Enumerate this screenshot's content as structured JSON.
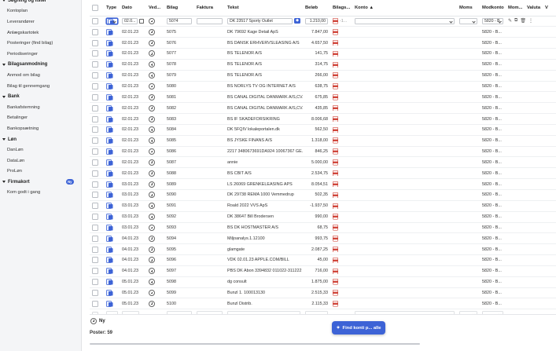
{
  "sidebar": {
    "items": [
      {
        "kind": "section",
        "label": "Søgning og lister"
      },
      {
        "kind": "item",
        "label": "Kontoplan"
      },
      {
        "kind": "item",
        "label": "Leverandører"
      },
      {
        "kind": "item",
        "label": "Anlægskartotek"
      },
      {
        "kind": "item",
        "label": "Posteringer (find bilag)"
      },
      {
        "kind": "item",
        "label": "Periodiseringer"
      },
      {
        "kind": "section",
        "label": "Bilagsanmodning"
      },
      {
        "kind": "item",
        "label": "Anmod om bilag"
      },
      {
        "kind": "item",
        "label": "Bilag til gennemgang"
      },
      {
        "kind": "section",
        "label": "Bank"
      },
      {
        "kind": "item",
        "label": "Bankafstemning"
      },
      {
        "kind": "item",
        "label": "Betalinger"
      },
      {
        "kind": "item",
        "label": "Bankopsætning"
      },
      {
        "kind": "section",
        "label": "Løn"
      },
      {
        "kind": "item",
        "label": "DanLøn"
      },
      {
        "kind": "item",
        "label": "DataLøn"
      },
      {
        "kind": "item",
        "label": "ProLøn"
      },
      {
        "kind": "section",
        "label": "Firmakort",
        "badge": "Ny"
      },
      {
        "kind": "item",
        "label": "Kom godt i gang"
      }
    ]
  },
  "table": {
    "columns": {
      "type": "Type",
      "dato": "Dato",
      "ved": "Ved...",
      "bilag": "Bilag",
      "faktura": "Faktura",
      "tekst": "Tekst",
      "belob": "Beløb",
      "bilags": "Bilags...",
      "konto": "Konto",
      "sort_indicator": "▲",
      "moms": "Moms",
      "modkonto": "Modkonto",
      "mom": "Mom...",
      "valuta": "Valuta",
      "v": "V"
    },
    "first_row": {
      "dato": "02.0...",
      "bilag": "5074",
      "tekst": "DK 23517 Sporty Outlet",
      "belob": "1.210,00",
      "bilags": "-1...",
      "modkonto": "5820 - B..."
    },
    "rows": [
      {
        "dato": "02.01.23",
        "bilag": "5075",
        "tekst": "DK 79692 Kage Detail ApS",
        "belob": "7.847,00",
        "modkonto": "5820 - B..."
      },
      {
        "dato": "02.01.23",
        "bilag": "5076",
        "tekst": "BS DANSK ERHVERVSLEASING A/S",
        "belob": "4.657,50",
        "modkonto": "5820 - B..."
      },
      {
        "dato": "02.01.23",
        "bilag": "5077",
        "tekst": "BS TELENOR A/S",
        "belob": "141,75",
        "modkonto": "5820 - B..."
      },
      {
        "dato": "02.01.23",
        "bilag": "5078",
        "tekst": "BS TELENOR A/S",
        "belob": "314,75",
        "modkonto": "5820 - B..."
      },
      {
        "dato": "02.01.23",
        "bilag": "5079",
        "tekst": "BS TELENOR A/S",
        "belob": "266,00",
        "modkonto": "5820 - B..."
      },
      {
        "dato": "02.01.23",
        "bilag": "5080",
        "tekst": "BS NORLYS TV OG INTERNET A/S",
        "belob": "638,75",
        "modkonto": "5820 - B..."
      },
      {
        "dato": "02.01.23",
        "bilag": "5081",
        "tekst": "BS CANAL DIGITAL DANMARK A/S,CV...",
        "belob": "675,85",
        "modkonto": "5820 - B..."
      },
      {
        "dato": "02.01.23",
        "bilag": "5082",
        "tekst": "BS CANAL DIGITAL DANMARK A/S,CV...",
        "belob": "435,85",
        "modkonto": "5820 - B..."
      },
      {
        "dato": "02.01.23",
        "bilag": "5083",
        "tekst": "BS IF SKADEFORSIKRING",
        "belob": "8.006,68",
        "modkonto": "5820 - B..."
      },
      {
        "dato": "02.01.23",
        "bilag": "5084",
        "tekst": "DK 5FQIV lokaleportalen.dk",
        "belob": "562,50",
        "modkonto": "5820 - B..."
      },
      {
        "dato": "02.01.23",
        "bilag": "5085",
        "tekst": "BS JYSKE FINANS A/S",
        "belob": "1.318,00",
        "modkonto": "5820 - B..."
      },
      {
        "dato": "02.01.23",
        "bilag": "5086",
        "tekst": "2217 3480673691DA924 10067367 GE...",
        "belob": "846,25",
        "modkonto": "5820 - B..."
      },
      {
        "dato": "02.01.23",
        "bilag": "5087",
        "tekst": "annie",
        "belob": "5.000,00",
        "modkonto": "5820 - B..."
      },
      {
        "dato": "02.01.23",
        "bilag": "5088",
        "tekst": "BS CBIT A/S",
        "belob": "2.534,75",
        "modkonto": "5820 - B..."
      },
      {
        "dato": "03.01.23",
        "bilag": "5089",
        "tekst": "LS 26069 GRENKELEASING APS",
        "belob": "8.054,51",
        "modkonto": "5820 - B..."
      },
      {
        "dato": "03.01.23",
        "bilag": "5090",
        "tekst": "DK 29738 REMA 1000 Vemmedrup",
        "belob": "502,35",
        "modkonto": "5820 - B..."
      },
      {
        "dato": "03.01.23",
        "bilag": "5091",
        "tekst": "Roald 2022 VVS ApS",
        "belob": "-1.937,50",
        "modkonto": "5820 - B..."
      },
      {
        "dato": "03.01.23",
        "bilag": "5092",
        "tekst": "DK 38647 Bill Brodersen",
        "belob": "990,00",
        "modkonto": "5820 - B..."
      },
      {
        "dato": "03.01.23",
        "bilag": "5093",
        "tekst": "BS DK HOSTMASTER A/S",
        "belob": "68,75",
        "modkonto": "5820 - B..."
      },
      {
        "dato": "04.01.23",
        "bilag": "5094",
        "tekst": "Miljoanalys.1.12100",
        "belob": "993,75",
        "modkonto": "5820 - B..."
      },
      {
        "dato": "04.01.23",
        "bilag": "5095",
        "tekst": "glamgate",
        "belob": "2.087,25",
        "modkonto": "5820 - B..."
      },
      {
        "dato": "04.01.23",
        "bilag": "5096",
        "tekst": "VDK 02.01.23 APPLE.COM/BILL",
        "belob": "45,00",
        "modkonto": "5820 - B..."
      },
      {
        "dato": "04.01.23",
        "bilag": "5097",
        "tekst": "PBS DK Abon 3394832 011022-311222",
        "belob": "716,00",
        "modkonto": "5820 - B..."
      },
      {
        "dato": "05.01.23",
        "bilag": "5098",
        "tekst": "dg consult",
        "belob": "1.875,00",
        "modkonto": "5820 - B..."
      },
      {
        "dato": "05.01.23",
        "bilag": "5099",
        "tekst": "Bunzl 1. 100013130",
        "belob": "2.515,33",
        "modkonto": "5820 - B..."
      },
      {
        "dato": "05.01.23",
        "bilag": "5100",
        "tekst": "Bunzl Distrib.",
        "belob": "2.115,33",
        "modkonto": "5820 - B..."
      }
    ]
  },
  "footer": {
    "add_label": "Ny",
    "posts_label": "Poster: 59",
    "find_button": "Find konti p... alle"
  },
  "colors": {
    "accent": "#3d63d6",
    "link": "#3460c8",
    "pdf_red": "#d0453a"
  }
}
